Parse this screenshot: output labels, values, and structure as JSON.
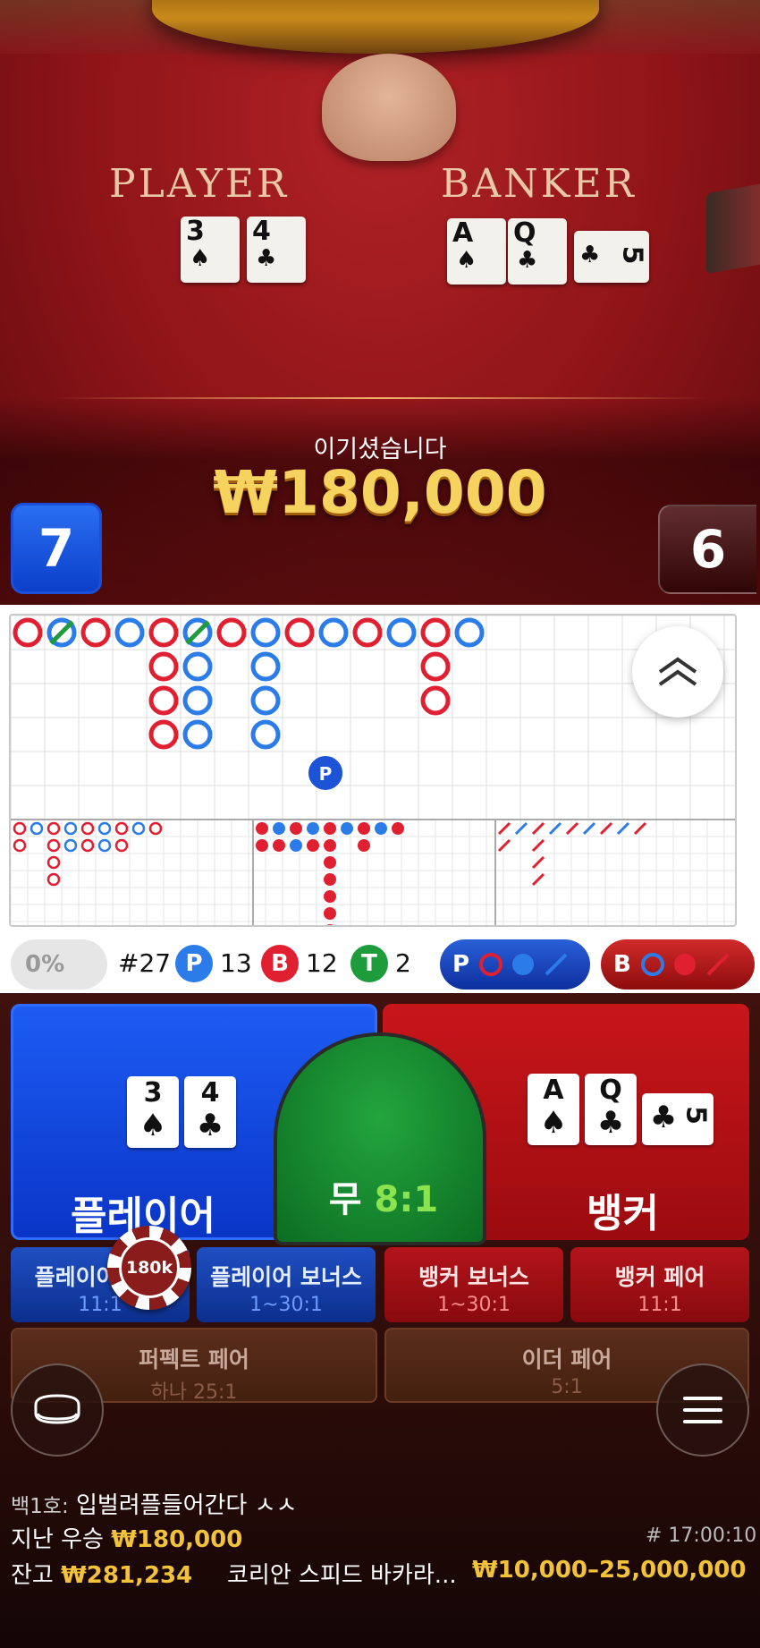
{
  "table": {
    "player_label": "PLAYER",
    "banker_label": "BANKER",
    "player_cards": [
      {
        "rank": "3",
        "suit": "♠"
      },
      {
        "rank": "4",
        "suit": "♣"
      }
    ],
    "banker_cards": [
      {
        "rank": "A",
        "suit": "♠"
      },
      {
        "rank": "Q",
        "suit": "♣"
      },
      {
        "rank": "5",
        "suit": "♣"
      }
    ]
  },
  "result": {
    "title": "이기셨습니다",
    "amount": "₩180,000",
    "player_score": "7",
    "banker_score": "6"
  },
  "roadmap": {
    "colors": {
      "player": "#2b7ce8",
      "banker": "#e02030",
      "tie": "#1e9b3a"
    },
    "big_road": [
      [
        "B"
      ],
      [
        "P"
      ],
      [
        "B"
      ],
      [
        "P"
      ],
      [
        "B",
        "B",
        "B",
        "B"
      ],
      [
        "P",
        "P",
        "P",
        "P"
      ],
      [
        "B"
      ],
      [
        "P",
        "P",
        "P",
        "P"
      ],
      [
        "B"
      ],
      [
        "P"
      ],
      [
        "B"
      ],
      [
        "P"
      ],
      [
        "B",
        "B",
        "B"
      ],
      [
        "P"
      ]
    ],
    "big_road_ties": [
      1,
      5
    ],
    "marker": "P",
    "stats": {
      "percent": "0%",
      "round": "#27",
      "p_letter": "P",
      "p_count": "13",
      "b_letter": "B",
      "b_count": "12",
      "t_letter": "T",
      "t_count": "2"
    },
    "predict_player_label": "P",
    "predict_banker_label": "B"
  },
  "bets": {
    "player_main": "플레이어",
    "tie_main": "무",
    "tie_odds": "8:1",
    "banker_main": "뱅커",
    "side": [
      {
        "title": "플레이어 페어",
        "odds": "11:1"
      },
      {
        "title": "플레이어 보너스",
        "odds": "1~30:1"
      },
      {
        "title": "뱅커 보너스",
        "odds": "1~30:1"
      },
      {
        "title": "뱅커 페어",
        "odds": "11:1"
      }
    ],
    "perfect_pair": {
      "title": "퍼펙트 페어",
      "odds": "하나 25:1"
    },
    "either_pair": {
      "title": "이더 페어",
      "odds": "5:1"
    },
    "chip_value": "180k"
  },
  "footer": {
    "chat_user": "백1호:",
    "chat_message": "입벌려플들어간다 ㅅㅅ",
    "last_win_label": "지난 우승",
    "last_win_amount": "₩180,000",
    "round_id": "# 17:00:10",
    "balance_label": "잔고",
    "balance": "₩281,234",
    "table_name": "코리안 스피드 바카라...",
    "limits": "₩10,000–25,000,000"
  }
}
